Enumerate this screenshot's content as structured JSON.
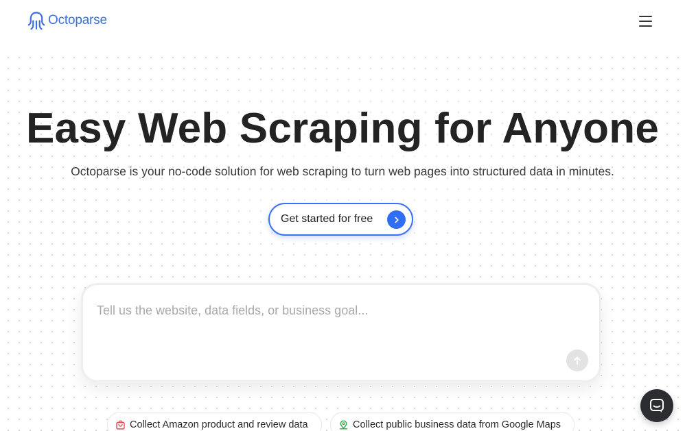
{
  "header": {
    "logo_text": "Octoparse",
    "menu_icon": "hamburger-menu-icon"
  },
  "hero": {
    "title": "Easy Web Scraping for Anyone",
    "subtitle": "Octoparse is your no-code solution for web scraping to turn web pages into structured data in minutes.",
    "cta_label": "Get started for free",
    "cta_icon": "chevron-right-icon"
  },
  "prompt": {
    "placeholder": "Tell us the website, data fields, or business goal...",
    "value": "",
    "send_icon": "arrow-up-icon"
  },
  "suggestions": [
    {
      "label": "Collect Amazon product and review data",
      "icon": "shopping-bag-icon",
      "icon_color": "#e8484d"
    },
    {
      "label": "Collect public business data from Google Maps",
      "icon": "map-pin-icon",
      "icon_color": "#2ea84a"
    }
  ],
  "chat": {
    "icon": "chat-bubble-icon"
  },
  "colors": {
    "brand": "#3b6fe0",
    "cta_border": "#3b72f0",
    "cta_arrow_bg": "#2f6ef2",
    "title": "#232323",
    "chat_bg": "#2b2d31"
  }
}
